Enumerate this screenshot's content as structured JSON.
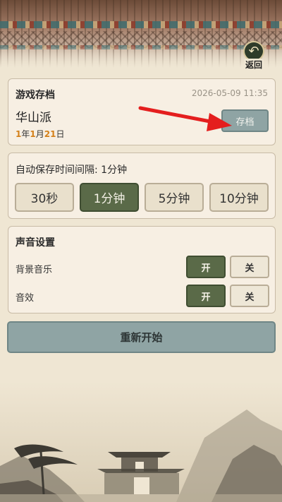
{
  "header": {
    "back_label": "返回",
    "back_icon": "back-arrow-icon"
  },
  "save_slot": {
    "title": "游戏存档",
    "timestamp": "2026-05-09 11:35",
    "sect_name": "华山派",
    "date": {
      "year": "1",
      "year_unit": "年",
      "month": "1",
      "month_unit": "月",
      "day": "21",
      "day_unit": "日"
    },
    "save_button": "存档"
  },
  "autosave": {
    "title": "自动保存时间间隔: 1分钟",
    "options": [
      "30秒",
      "1分钟",
      "5分钟",
      "10分钟"
    ],
    "selected": "1分钟"
  },
  "sound": {
    "title": "声音设置",
    "bgm": {
      "label": "背景音乐",
      "on": "开",
      "off": "关",
      "state": "on"
    },
    "sfx": {
      "label": "音效",
      "on": "开",
      "off": "关",
      "state": "on"
    }
  },
  "restart_button": "重新开始",
  "colors": {
    "accent_green": "#5a6a48",
    "button_teal": "#8fa4a4",
    "highlight_orange": "#d4801a",
    "annotation_red": "#e41e1e"
  }
}
